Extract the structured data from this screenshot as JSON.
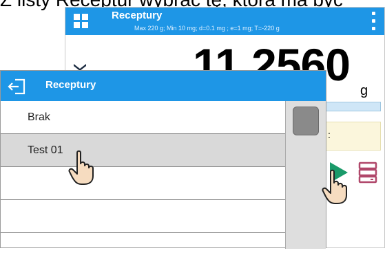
{
  "caption": "Z listy Receptur wybrać tę, która ma być",
  "balance": {
    "title": "Receptury",
    "subtitle": "Max 220 g; Min 10 mg; d=0.1 mg ; e=1 mg; T=-220 g",
    "weight": "11.2560",
    "unit": "g",
    "info_text": ":"
  },
  "panel": {
    "title": "Receptury",
    "items": [
      "Brak",
      "Test 01",
      "",
      "",
      ""
    ],
    "selected_index": 1
  },
  "colors": {
    "header": "#1e96e6",
    "selected_row": "#d9d9d9",
    "play": "#1a9a6a",
    "database": "#b0476a"
  },
  "icons": [
    "grid-icon",
    "menu-dots-icon",
    "back-arrow-icon",
    "play-icon",
    "database-icon",
    "pointing-hand-icon"
  ]
}
